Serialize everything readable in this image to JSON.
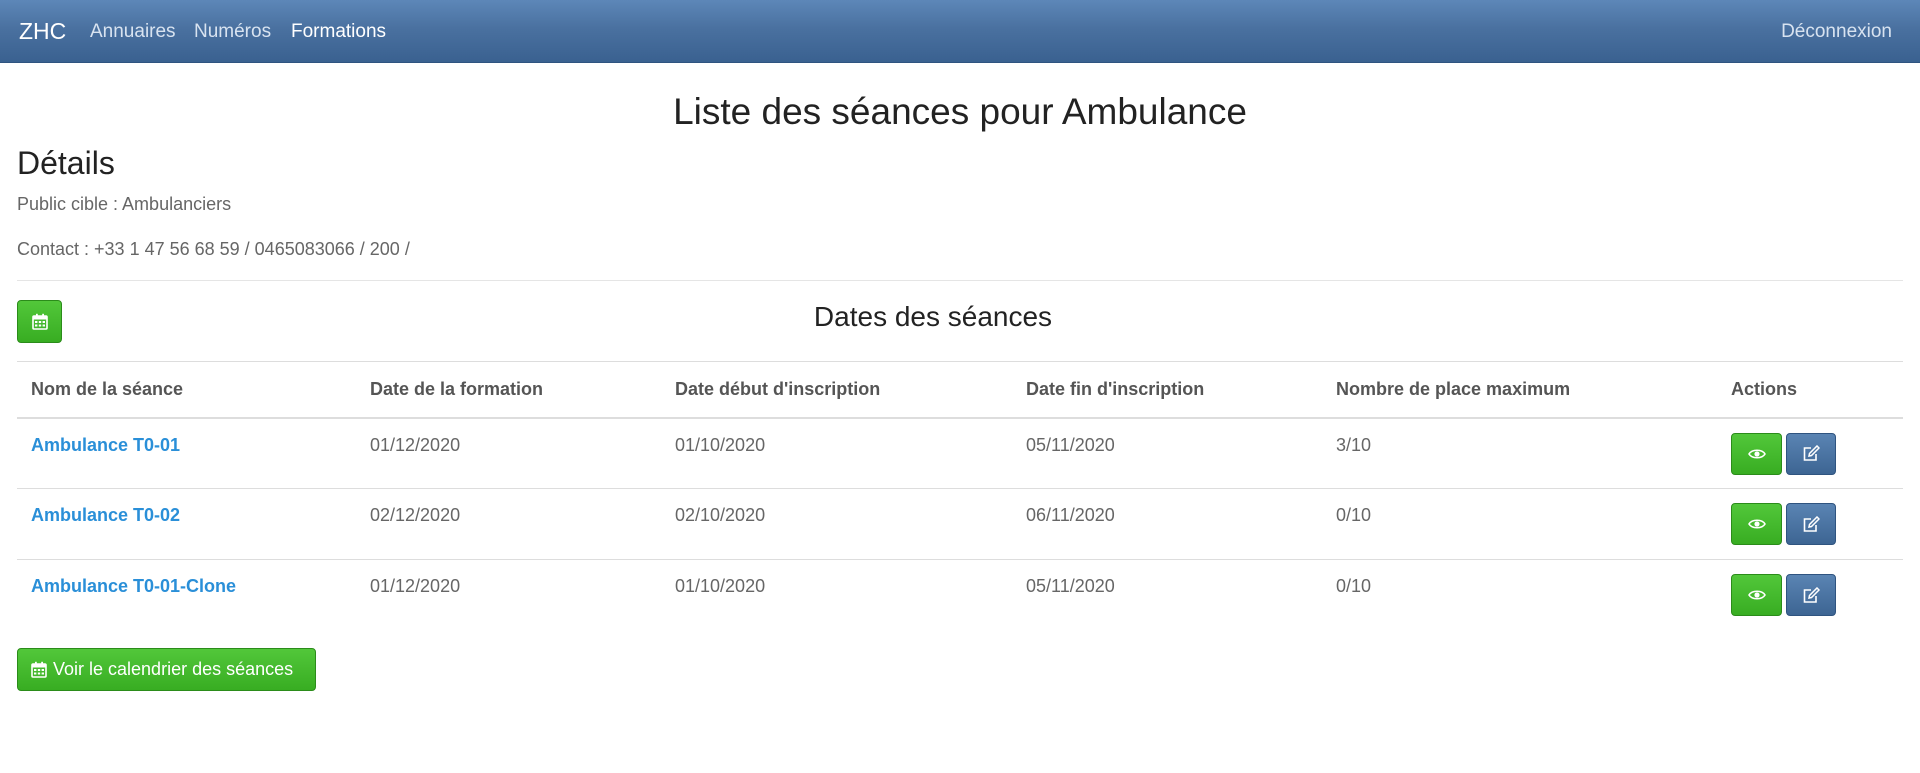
{
  "navbar": {
    "brand": "ZHC",
    "links": [
      {
        "label": "Annuaires"
      },
      {
        "label": "Numéros"
      },
      {
        "label": "Formations",
        "active": true
      }
    ],
    "logout": "Déconnexion"
  },
  "page": {
    "title": "Liste des séances pour Ambulance",
    "details_title": "Détails",
    "public_cible": "Public cible : Ambulanciers",
    "contact": "Contact : +33 1 47 56 68 59 / 0465083066 / 200 /"
  },
  "sessions": {
    "title": "Dates des séances",
    "calendar_icon": "calendar-icon",
    "headers": {
      "name": "Nom de la séance",
      "date": "Date de la formation",
      "start": "Date début d'inscription",
      "end": "Date fin d'inscription",
      "max": "Nombre de place maximum",
      "actions": "Actions"
    },
    "rows": [
      {
        "name": "Ambulance T0-01",
        "date": "01/12/2020",
        "start": "01/10/2020",
        "end": "05/11/2020",
        "max": "3/10"
      },
      {
        "name": "Ambulance T0-02",
        "date": "02/12/2020",
        "start": "02/10/2020",
        "end": "06/11/2020",
        "max": "0/10"
      },
      {
        "name": "Ambulance T0-01-Clone",
        "date": "01/12/2020",
        "start": "01/10/2020",
        "end": "05/11/2020",
        "max": "0/10"
      }
    ],
    "calendar_button": "Voir le calendrier des séances"
  },
  "colors": {
    "navbar": "#4a71a0",
    "green_button": "#3fb52a",
    "blue_button": "#4a71a0",
    "link": "#2a8fd8"
  }
}
